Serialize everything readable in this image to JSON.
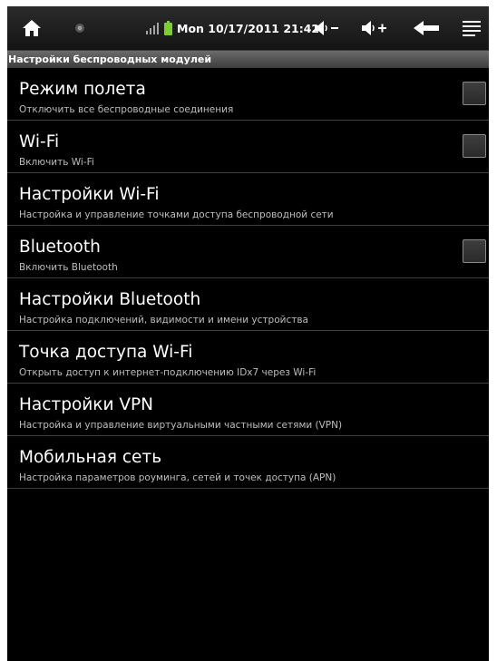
{
  "status_bar": {
    "icons": [
      "home-icon",
      "notification-dot-icon",
      "signal-icon",
      "battery-icon",
      "volume-down-icon",
      "volume-up-icon",
      "back-icon",
      "menu-icon"
    ],
    "clock": "Mon 10/17/2011 21:42",
    "battery_color": "#7ccf2a",
    "signal_color": "#a4a4a4"
  },
  "header": {
    "title": "Настройки беспроводных модулей"
  },
  "items": [
    {
      "title": "Режим полета",
      "subtitle": "Отключить все беспроводные соединения",
      "checkbox": true,
      "checked": false
    },
    {
      "title": "Wi-Fi",
      "subtitle": "Включить Wi-Fi",
      "checkbox": true,
      "checked": false
    },
    {
      "title": "Настройки Wi-Fi",
      "subtitle": "Настройка и управление точками доступа беспроводной сети",
      "checkbox": false
    },
    {
      "title": "Bluetooth",
      "subtitle": "Включить Bluetooth",
      "checkbox": true,
      "checked": false
    },
    {
      "title": "Настройки Bluetooth",
      "subtitle": "Настройка подключений, видимости и имени устройства",
      "checkbox": false
    },
    {
      "title": "Точка доступа Wi-Fi",
      "subtitle": "Открыть доступ к интернет-подключению IDx7 через Wi-Fi",
      "checkbox": false
    },
    {
      "title": "Настройки VPN",
      "subtitle": "Настройка и управление виртуальными частными сетями (VPN)",
      "checkbox": false
    },
    {
      "title": "Мобильная сеть",
      "subtitle": "Настройка параметров роуминга, сетей и точек доступа (APN)",
      "checkbox": false
    }
  ]
}
